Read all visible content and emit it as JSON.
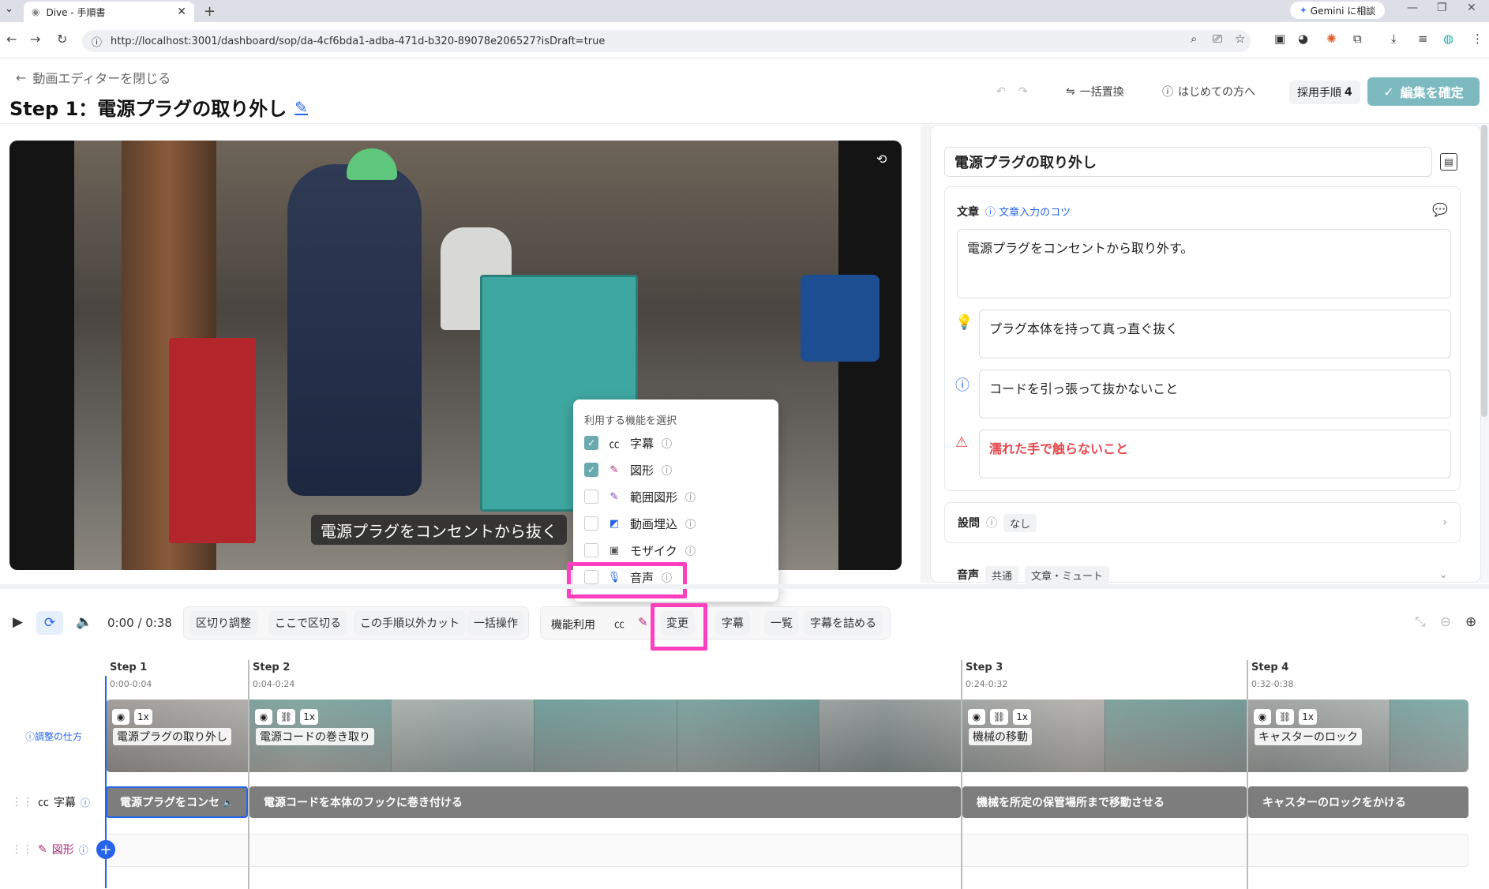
{
  "browser": {
    "tab_title": "Dive - 手順書",
    "url": "http://localhost:3001/dashboard/sop/da-4cf6bda1-adba-471d-b320-89078e206527?isDraft=true",
    "gemini": "Gemini に相談"
  },
  "header": {
    "back_label": "動画エディターを閉じる",
    "title": "Step 1：電源プラグの取り外し",
    "replace": "一括置換",
    "help": "はじめての方へ",
    "adopt_label": "採用手順",
    "adopt_count": "4",
    "confirm": "編集を確定"
  },
  "video": {
    "subtitle": "電源プラグをコンセントから抜く"
  },
  "popover": {
    "title": "利用する機能を選択",
    "options": [
      {
        "label": "字幕",
        "checked": true,
        "icon": "cc-icon"
      },
      {
        "label": "図形",
        "checked": true,
        "icon": "pen-icon"
      },
      {
        "label": "範囲図形",
        "checked": false,
        "icon": "pen-icon"
      },
      {
        "label": "動画埋込",
        "checked": false,
        "icon": "embed-icon"
      },
      {
        "label": "モザイク",
        "checked": false,
        "icon": "mosaic-icon"
      },
      {
        "label": "音声",
        "checked": false,
        "icon": "mic-icon"
      }
    ]
  },
  "panel": {
    "step_title": "電源プラグの取り外し",
    "text_label": "文章",
    "tip_link": "文章入力のコツ",
    "main_text": "電源プラグをコンセントから取り外す。",
    "tip_text": "プラグ本体を持って真っ直ぐ抜く",
    "note_text": "コードを引っ張って抜かないこと",
    "warn_text": "濡れた手で触らないこと",
    "question_label": "設問",
    "question_value": "なし",
    "audio_label": "音声",
    "audio_chip1": "共通",
    "audio_chip2": "文章・ミュート",
    "warn_color": "#e5484d"
  },
  "toolbar": {
    "time": "0:00 / 0:38",
    "b1": "区切り調整",
    "b2": "ここで区切る",
    "b3": "この手順以外カット",
    "b4": "一括操作",
    "feature": "機能利用",
    "change": "変更",
    "subtitles": "字幕",
    "list": "一覧",
    "pack": "字幕を詰める"
  },
  "timeline": {
    "howto": "調整の仕方",
    "subtitle_row": "字幕",
    "figure_row": "図形",
    "speed": "1x",
    "steps": [
      {
        "name": "Step 1",
        "time": "0:00-0:04",
        "label": "電源プラグの取り外し",
        "subtitle": "電源プラグをコンセ"
      },
      {
        "name": "Step 2",
        "time": "0:04-0:24",
        "label": "電源コードの巻き取り",
        "subtitle": "電源コードを本体のフックに巻き付ける"
      },
      {
        "name": "Step 3",
        "time": "0:24-0:32",
        "label": "機械の移動",
        "subtitle": "機械を所定の保管場所まで移動させる"
      },
      {
        "name": "Step 4",
        "time": "0:32-0:38",
        "label": "キャスターのロック",
        "subtitle": "キャスターのロックをかける"
      }
    ]
  }
}
